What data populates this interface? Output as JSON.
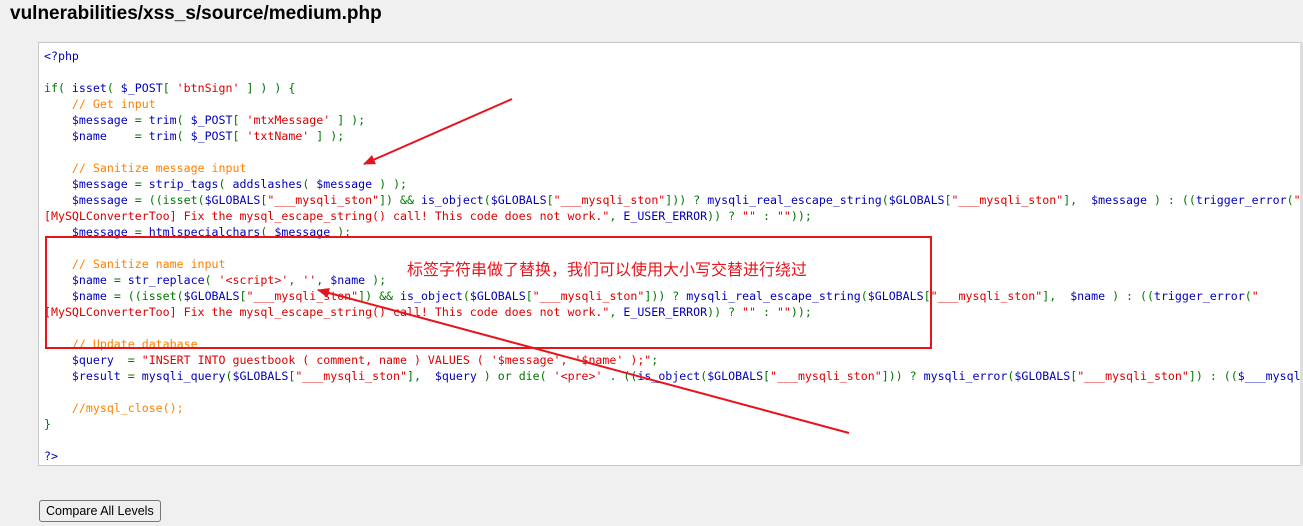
{
  "page": {
    "title": "vulnerabilities/xss_s/source/medium.php"
  },
  "code_lines": [
    [
      [
        "default",
        "<?php"
      ]
    ],
    [],
    [
      [
        "keyword",
        "if( "
      ],
      [
        "default",
        "isset"
      ],
      [
        "keyword",
        "( "
      ],
      [
        "default",
        "$_POST"
      ],
      [
        "keyword",
        "[ "
      ],
      [
        "string",
        "'btnSign'"
      ],
      [
        "keyword",
        " ] ) ) {"
      ]
    ],
    [
      [
        "comment",
        "    // Get input"
      ]
    ],
    [
      [
        "default",
        "    $message "
      ],
      [
        "keyword",
        "= "
      ],
      [
        "default",
        "trim"
      ],
      [
        "keyword",
        "( "
      ],
      [
        "default",
        "$_POST"
      ],
      [
        "keyword",
        "[ "
      ],
      [
        "string",
        "'mtxMessage'"
      ],
      [
        "keyword",
        " ] );"
      ]
    ],
    [
      [
        "default",
        "    $name    "
      ],
      [
        "keyword",
        "= "
      ],
      [
        "default",
        "trim"
      ],
      [
        "keyword",
        "( "
      ],
      [
        "default",
        "$_POST"
      ],
      [
        "keyword",
        "[ "
      ],
      [
        "string",
        "'txtName'"
      ],
      [
        "keyword",
        " ] );"
      ]
    ],
    [],
    [
      [
        "comment",
        "    // Sanitize message input"
      ]
    ],
    [
      [
        "default",
        "    $message "
      ],
      [
        "keyword",
        "= "
      ],
      [
        "default",
        "strip_tags"
      ],
      [
        "keyword",
        "( "
      ],
      [
        "default",
        "addslashes"
      ],
      [
        "keyword",
        "( "
      ],
      [
        "default",
        "$message "
      ],
      [
        "keyword",
        ") );"
      ]
    ],
    [
      [
        "default",
        "    $message "
      ],
      [
        "keyword",
        "= ((isset("
      ],
      [
        "default",
        "$GLOBALS"
      ],
      [
        "keyword",
        "["
      ],
      [
        "string",
        "\"___mysqli_ston\""
      ],
      [
        "keyword",
        "]) && "
      ],
      [
        "default",
        "is_object"
      ],
      [
        "keyword",
        "("
      ],
      [
        "default",
        "$GLOBALS"
      ],
      [
        "keyword",
        "["
      ],
      [
        "string",
        "\"___mysqli_ston\""
      ],
      [
        "keyword",
        "])) ? "
      ],
      [
        "default",
        "mysqli_real_escape_string"
      ],
      [
        "keyword",
        "("
      ],
      [
        "default",
        "$GLOBALS"
      ],
      [
        "keyword",
        "["
      ],
      [
        "string",
        "\"___mysqli_ston\""
      ],
      [
        "keyword",
        "],  "
      ],
      [
        "default",
        "$message "
      ],
      [
        "keyword",
        ") : (("
      ],
      [
        "default",
        "trigger_error"
      ],
      [
        "keyword",
        "("
      ],
      [
        "string",
        "\""
      ]
    ],
    [
      [
        "string",
        "[MySQLConverterToo] Fix the mysql_escape_string() call! This code does not work.\""
      ],
      [
        "keyword",
        ", "
      ],
      [
        "default",
        "E_USER_ERROR"
      ],
      [
        "keyword",
        ")) ? "
      ],
      [
        "string",
        "\"\""
      ],
      [
        "keyword",
        " : "
      ],
      [
        "string",
        "\"\""
      ],
      [
        "keyword",
        "));"
      ]
    ],
    [
      [
        "default",
        "    $message "
      ],
      [
        "keyword",
        "= "
      ],
      [
        "default",
        "htmlspecialchars"
      ],
      [
        "keyword",
        "( "
      ],
      [
        "default",
        "$message "
      ],
      [
        "keyword",
        ");"
      ]
    ],
    [],
    [
      [
        "comment",
        "    // Sanitize name input"
      ]
    ],
    [
      [
        "default",
        "    $name "
      ],
      [
        "keyword",
        "= "
      ],
      [
        "default",
        "str_replace"
      ],
      [
        "keyword",
        "( "
      ],
      [
        "string",
        "'<script>'"
      ],
      [
        "keyword",
        ", "
      ],
      [
        "string",
        "''"
      ],
      [
        "keyword",
        ", "
      ],
      [
        "default",
        "$name "
      ],
      [
        "keyword",
        ");"
      ]
    ],
    [
      [
        "default",
        "    $name "
      ],
      [
        "keyword",
        "= ((isset("
      ],
      [
        "default",
        "$GLOBALS"
      ],
      [
        "keyword",
        "["
      ],
      [
        "string",
        "\"___mysqli_ston\""
      ],
      [
        "keyword",
        "]) && "
      ],
      [
        "default",
        "is_object"
      ],
      [
        "keyword",
        "("
      ],
      [
        "default",
        "$GLOBALS"
      ],
      [
        "keyword",
        "["
      ],
      [
        "string",
        "\"___mysqli_ston\""
      ],
      [
        "keyword",
        "])) ? "
      ],
      [
        "default",
        "mysqli_real_escape_string"
      ],
      [
        "keyword",
        "("
      ],
      [
        "default",
        "$GLOBALS"
      ],
      [
        "keyword",
        "["
      ],
      [
        "string",
        "\"___mysqli_ston\""
      ],
      [
        "keyword",
        "],  "
      ],
      [
        "default",
        "$name "
      ],
      [
        "keyword",
        ") : (("
      ],
      [
        "default",
        "trigger_error"
      ],
      [
        "keyword",
        "("
      ],
      [
        "string",
        "\""
      ]
    ],
    [
      [
        "string",
        "[MySQLConverterToo] Fix the mysql_escape_string() call! This code does not work.\""
      ],
      [
        "keyword",
        ", "
      ],
      [
        "default",
        "E_USER_ERROR"
      ],
      [
        "keyword",
        ")) ? "
      ],
      [
        "string",
        "\"\""
      ],
      [
        "keyword",
        " : "
      ],
      [
        "string",
        "\"\""
      ],
      [
        "keyword",
        "));"
      ]
    ],
    [],
    [
      [
        "comment",
        "    // Update database"
      ]
    ],
    [
      [
        "default",
        "    $query  "
      ],
      [
        "keyword",
        "= "
      ],
      [
        "string",
        "\"INSERT INTO guestbook ( comment, name ) VALUES ( '$message', '$name' );\""
      ],
      [
        "keyword",
        ";"
      ]
    ],
    [
      [
        "default",
        "    $result "
      ],
      [
        "keyword",
        "= "
      ],
      [
        "default",
        "mysqli_query"
      ],
      [
        "keyword",
        "("
      ],
      [
        "default",
        "$GLOBALS"
      ],
      [
        "keyword",
        "["
      ],
      [
        "string",
        "\"___mysqli_ston\""
      ],
      [
        "keyword",
        "],  "
      ],
      [
        "default",
        "$query "
      ],
      [
        "keyword",
        ") or die( "
      ],
      [
        "string",
        "'<pre>'"
      ],
      [
        "keyword",
        " . (("
      ],
      [
        "default",
        "is_object"
      ],
      [
        "keyword",
        "("
      ],
      [
        "default",
        "$GLOBALS"
      ],
      [
        "keyword",
        "["
      ],
      [
        "string",
        "\"___mysqli_ston\""
      ],
      [
        "keyword",
        "])) ? "
      ],
      [
        "default",
        "mysqli_error"
      ],
      [
        "keyword",
        "("
      ],
      [
        "default",
        "$GLOBALS"
      ],
      [
        "keyword",
        "["
      ],
      [
        "string",
        "\"___mysqli_ston\""
      ],
      [
        "keyword",
        "]) : (("
      ],
      [
        "default",
        "$___mysqli_res "
      ],
      [
        "keyword",
        "= "
      ],
      [
        "default",
        "mysqli_connect_error"
      ],
      [
        "keyword",
        "()) ? "
      ],
      [
        "default",
        "$___mysqli_res "
      ],
      [
        "keyword",
        ": "
      ],
      [
        "default",
        "false"
      ],
      [
        "keyword",
        ")) . "
      ],
      [
        "string",
        "'</pre>'"
      ],
      [
        "keyword",
        " );"
      ]
    ],
    [],
    [
      [
        "comment",
        "    //mysql_close();"
      ]
    ],
    [
      [
        "keyword",
        "}"
      ]
    ],
    [],
    [
      [
        "default",
        "?>"
      ]
    ]
  ],
  "annotation": {
    "text": "标签字符串做了替换，我们可以使用大小写交替进行绕过",
    "color": "#e8141c"
  },
  "compare_button": {
    "label": "Compare All Levels"
  },
  "colors": {
    "default": "#0000bb",
    "keyword": "#007700",
    "string": "#dd0000",
    "comment": "#ff8000"
  }
}
